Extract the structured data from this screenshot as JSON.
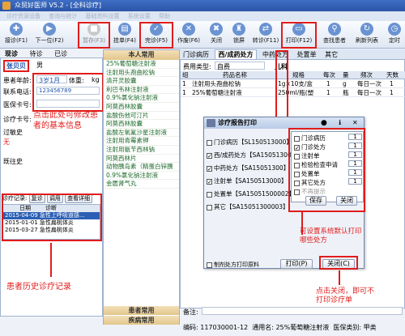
{
  "window": {
    "title": "众贸好医师 V5.2 - [全科诊疗]"
  },
  "menu": [
    "诊疗资源设备",
    "查询与统计",
    "基础资料设置",
    "系统设置",
    "帮助"
  ],
  "toolbar": [
    {
      "label": "接诊(F1)",
      "icon": "stethoscope-icon",
      "enabled": true
    },
    {
      "label": "下一位(F2)",
      "icon": "next-patient-icon",
      "enabled": true
    },
    {
      "label": "暂存(F3)",
      "icon": "save-draft-icon",
      "enabled": false
    },
    {
      "label": "挂单(F4)",
      "icon": "hold-icon",
      "enabled": true
    },
    {
      "label": "完诊(F5)",
      "icon": "finish-icon",
      "enabled": true
    },
    {
      "label": "作废(F6)",
      "icon": "void-icon",
      "enabled": true
    },
    {
      "label": "关闭",
      "icon": "close-icon",
      "enabled": true
    },
    {
      "label": "锁屏",
      "icon": "lock-icon",
      "enabled": true
    },
    {
      "label": "转诊(F11)",
      "icon": "transfer-icon",
      "enabled": true
    },
    {
      "label": "打印(F12)",
      "icon": "print-icon",
      "enabled": true
    },
    {
      "label": "查找患者",
      "icon": "search-icon",
      "enabled": true
    },
    {
      "label": "刷新列表",
      "icon": "refresh-icon",
      "enabled": true
    },
    {
      "label": "定时",
      "icon": "timer-icon",
      "enabled": true
    }
  ],
  "left": {
    "tabs": [
      "现诊",
      "待诊",
      "已诊"
    ],
    "patient_name": "张贝贝",
    "gender": "男",
    "age_label": "患者年龄:",
    "age_value": "3岁1月",
    "weight_label": "体重:",
    "weight_unit": "kg",
    "phone_label": "联系电话:",
    "phone_value": "123456789",
    "insurance_label": "医保卡号:",
    "card_label": "诊疗卡号:",
    "allergy_label": "过敏史",
    "allergy_value": "无",
    "past_label": "既往史",
    "annotation_info": "点击此处可修改患者的基本信息",
    "history_label": "诊疗记录:",
    "history_buttons": [
      "复诊",
      "调用",
      "查看详细"
    ],
    "history_header": [
      "日期",
      "诊断"
    ],
    "history_rows": [
      {
        "date": "2015-04-09",
        "diag": "急性上呼吸道感..."
      },
      {
        "date": "2015-01-01",
        "diag": "急性扁桃体炎"
      },
      {
        "date": "2015-03-27",
        "diag": "急性扁桃体炎"
      }
    ],
    "annotation_history": "患者历史诊疗记录"
  },
  "middle": {
    "header": "本人常用",
    "drugs": [
      "25%葡萄糖注射液",
      "注射用头孢曲松钠",
      "清开灵胶囊",
      "利巴韦林注射液",
      "0.9%氯化钠注射液",
      "阿莫西林胶囊",
      "盐酸伤他可汀片",
      "阿莫西林胶囊",
      "盐酸左氧氟沙星注射液",
      "注射用青霉素钾",
      "注射用氨苄西林钠",
      "阿莫西林片",
      "动物胰岛素（精蛋白锌胰",
      "0.9%氯化钠注射液",
      "金匮肾气丸"
    ],
    "footer1": "患者常用",
    "footer2": "疾病常用"
  },
  "rx": {
    "tabs": [
      "门诊病历",
      "西/成药处方",
      "中药处方",
      "处置单",
      "其它"
    ],
    "fee_label": "费用类型:",
    "fee_value": "自费",
    "dept": "儿科",
    "columns": [
      "组",
      "",
      "药品名称",
      "规格",
      "每次",
      "量",
      "频次",
      "天数"
    ],
    "rows": [
      {
        "group": "1",
        "mark": "",
        "name": "注射用头孢曲松钠",
        "spec": "1g×10支/盒",
        "dose": "1",
        "unit": "g",
        "freq": "每日一次",
        "days": "1"
      },
      {
        "group": "1",
        "mark": "",
        "name": "25%葡萄糖注射液",
        "spec": "250ml/瓶(塑",
        "dose": "1",
        "unit": "瓶",
        "freq": "每日一次",
        "days": "1"
      }
    ],
    "note_label": "备注:",
    "code_label": "编码:",
    "code_value": "117030001-12",
    "generic_label": "通用名:",
    "generic_value": "25%葡萄糖注射液",
    "insurance_type_label": "医保类别:",
    "insurance_type_value": "甲类"
  },
  "dialog": {
    "title": "诊疗报告打印",
    "items": [
      {
        "label": "门诊病历【SL150513000】",
        "checked": false
      },
      {
        "label": "西/成药处方【SA15051300】",
        "checked": true
      },
      {
        "label": "中药处方【SA15051300】",
        "checked": true
      },
      {
        "label": "注射单【SA150513000】",
        "checked": true
      },
      {
        "label": "处置单【SA15051500002】",
        "checked": false
      },
      {
        "label": "其它【SA15051300003】",
        "checked": false
      }
    ],
    "options": [
      {
        "label": "门诊病历",
        "checked": false,
        "copies": "1"
      },
      {
        "label": "门诊处方",
        "checked": true,
        "copies": "1"
      },
      {
        "label": "注射单",
        "checked": false,
        "copies": "1"
      },
      {
        "label": "检验检查申请",
        "checked": false,
        "copies": "1"
      },
      {
        "label": "处置单",
        "checked": false,
        "copies": "1"
      },
      {
        "label": "其它处方",
        "checked": false,
        "copies": "1"
      },
      {
        "label": "不再提示",
        "checked": false,
        "copies": ""
      }
    ],
    "save_label": "保存",
    "close_small_label": "关闭",
    "print_copy_label": "制剂处方打印原料",
    "print_button": "打印(P)",
    "close_button": "关闭(C)",
    "annotation_default": "可设置系统默认打印哪些处方",
    "annotation_close": "点击关闭，即可不打印诊疗单"
  }
}
